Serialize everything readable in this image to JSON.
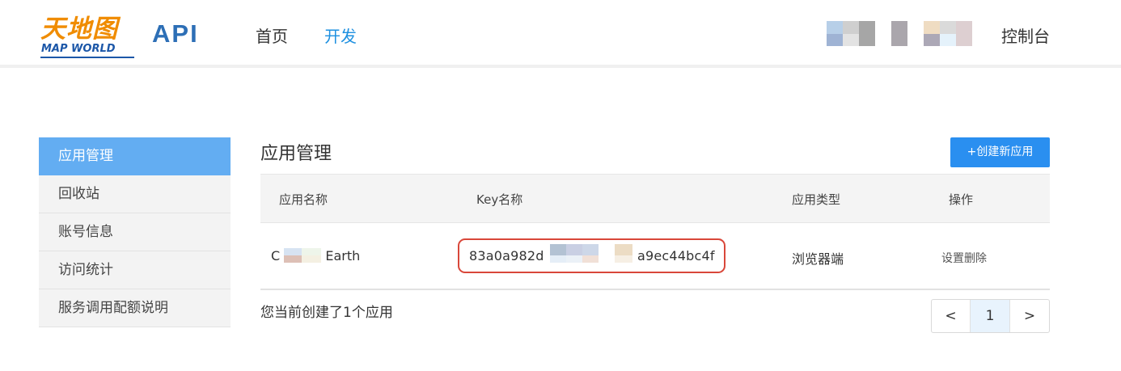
{
  "header": {
    "logo_cn": "天地图",
    "logo_en": "MAP WORLD",
    "brand": "API",
    "nav": [
      {
        "label": "首页"
      },
      {
        "label": "开发"
      }
    ],
    "console_label": "控制台"
  },
  "sidebar": {
    "items": [
      {
        "label": "应用管理"
      },
      {
        "label": "回收站"
      },
      {
        "label": "账号信息"
      },
      {
        "label": "访问统计"
      },
      {
        "label": "服务调用配额说明"
      }
    ]
  },
  "main": {
    "title": "应用管理",
    "create_button": "+创建新应用",
    "table": {
      "headers": [
        "应用名称",
        "Key名称",
        "应用类型",
        "操作"
      ],
      "rows": [
        {
          "name_prefix": "C",
          "name_suffix": "Earth",
          "key_prefix": "83a0a982d",
          "key_suffix": "a9ec44bc4f",
          "type": "浏览器端",
          "ops": "设置删除"
        }
      ]
    },
    "summary": "您当前创建了1个应用",
    "pagination": {
      "prev": "<",
      "current": "1",
      "next": ">"
    }
  },
  "colors": {
    "accent": "#2a8ff0",
    "sidebar_active": "#63adf2",
    "highlight_border": "#d9473a",
    "logo_orange": "#f08c00",
    "logo_blue": "#1c57a8"
  }
}
